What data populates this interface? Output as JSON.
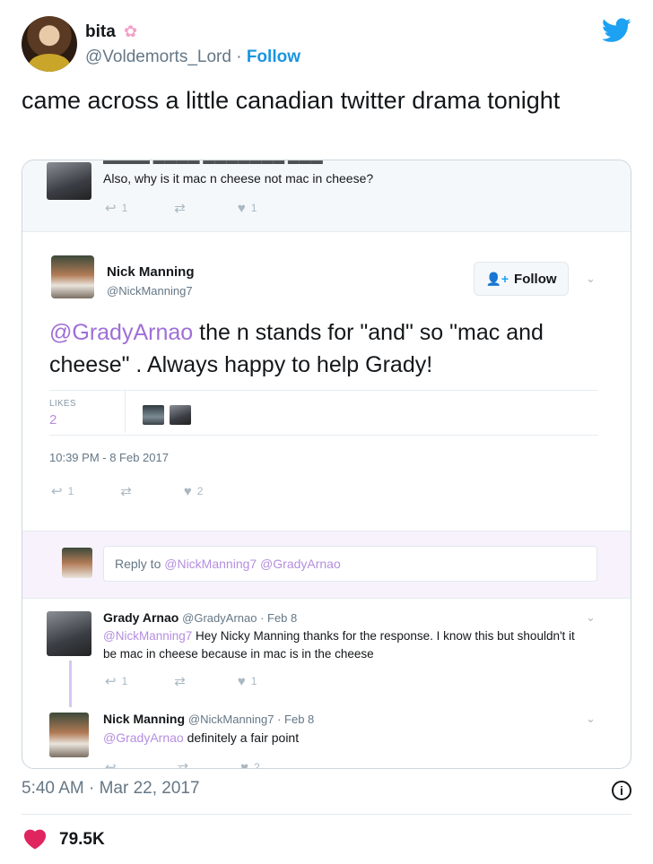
{
  "tweet": {
    "display_name": "bita",
    "handle": "@Voldemorts_Lord",
    "separator": "·",
    "follow_label": "Follow",
    "text": "came across a little canadian twitter drama tonight",
    "timestamp": "5:40 AM · Mar 22, 2017",
    "like_count": "79.5K",
    "icons": [
      "flower-emoji",
      "twitter-bird-icon",
      "info-icon",
      "heart-icon"
    ],
    "colors": {
      "accent": "#1b95e0",
      "heart": "#e0245e",
      "secondary_text": "#657786"
    }
  },
  "screenshot": {
    "context_tweet": {
      "text": "Also, why is it mac n cheese not mac in cheese?",
      "reply_count": "1",
      "like_count": "1"
    },
    "main_tweet": {
      "name": "Nick Manning",
      "handle": "@NickManning7",
      "follow_label": "Follow",
      "mention": "@GradyArnao",
      "text": " the n stands for \"and\" so \"mac and cheese\" . Always happy to help Grady!",
      "likes_label": "LIKES",
      "likes_count": "2",
      "timestamp": "10:39 PM - 8 Feb 2017",
      "reply_count": "1",
      "like_count": "2"
    },
    "reply_composer": {
      "prefix": "Reply to ",
      "mentions": "@NickManning7 @GradyArnao"
    },
    "replies": [
      {
        "name": "Grady Arnao",
        "meta": "@GradyArnao · Feb 8",
        "mention": "@NickManning7",
        "text": " Hey Nicky Manning thanks for the response. I know this but shouldn't it be mac in cheese because in mac is in the cheese",
        "reply_count": "1",
        "like_count": "1"
      },
      {
        "name": "Nick Manning",
        "meta": "@NickManning7 · Feb 8",
        "mention": "@GradyArnao",
        "text": " definitely a fair point",
        "like_count": "2"
      }
    ],
    "colors": {
      "mention": "#9f6fd6",
      "follow_icon": "#1da1f2"
    }
  }
}
